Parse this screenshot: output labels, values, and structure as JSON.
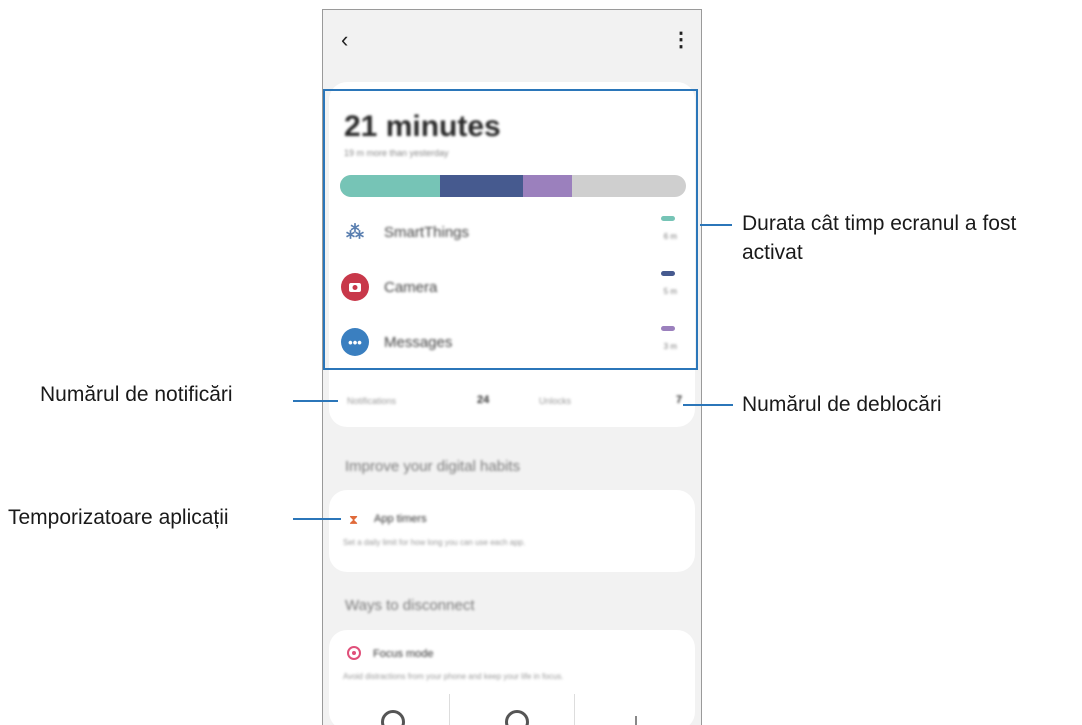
{
  "screen": {
    "back_icon": "chevron-left-icon",
    "more_icon": "more-vertical-icon",
    "total_time": "21 minutes",
    "comparison": "19 m more than yesterday",
    "usage_segments": [
      {
        "color": "#76c4b6",
        "fraction": 0.29
      },
      {
        "color": "#465a8f",
        "fraction": 0.24
      },
      {
        "color": "#9b80bd",
        "fraction": 0.14
      }
    ],
    "apps": [
      {
        "name": "SmartThings",
        "time": "6 m",
        "color": "#76c4b6",
        "icon": "smartthings-icon"
      },
      {
        "name": "Camera",
        "time": "5 m",
        "color": "#465a8f",
        "icon": "camera-icon"
      },
      {
        "name": "Messages",
        "time": "3 m",
        "color": "#9b80bd",
        "icon": "messages-icon"
      }
    ],
    "notifications_label": "Notifications",
    "notifications_value": "24",
    "unlocks_label": "Unlocks",
    "unlocks_value": "7",
    "section_habits": "Improve your digital habits",
    "app_timers_title": "App timers",
    "app_timers_desc": "Set a daily limit for how long you can use each app.",
    "section_disconnect": "Ways to disconnect",
    "focus_title": "Focus mode",
    "focus_desc": "Avoid distractions from your phone and keep your life in focus."
  },
  "callouts": {
    "screen_time_line1": "Durata cât timp ecranul a fost",
    "screen_time_line2": "activat",
    "notifications": "Numărul de notificări",
    "unlocks": "Numărul de deblocări",
    "app_timers": "Temporizatoare aplicații"
  },
  "colors": {
    "accent": "#2b76b9",
    "bar_remaining": "#cfcfcf"
  }
}
